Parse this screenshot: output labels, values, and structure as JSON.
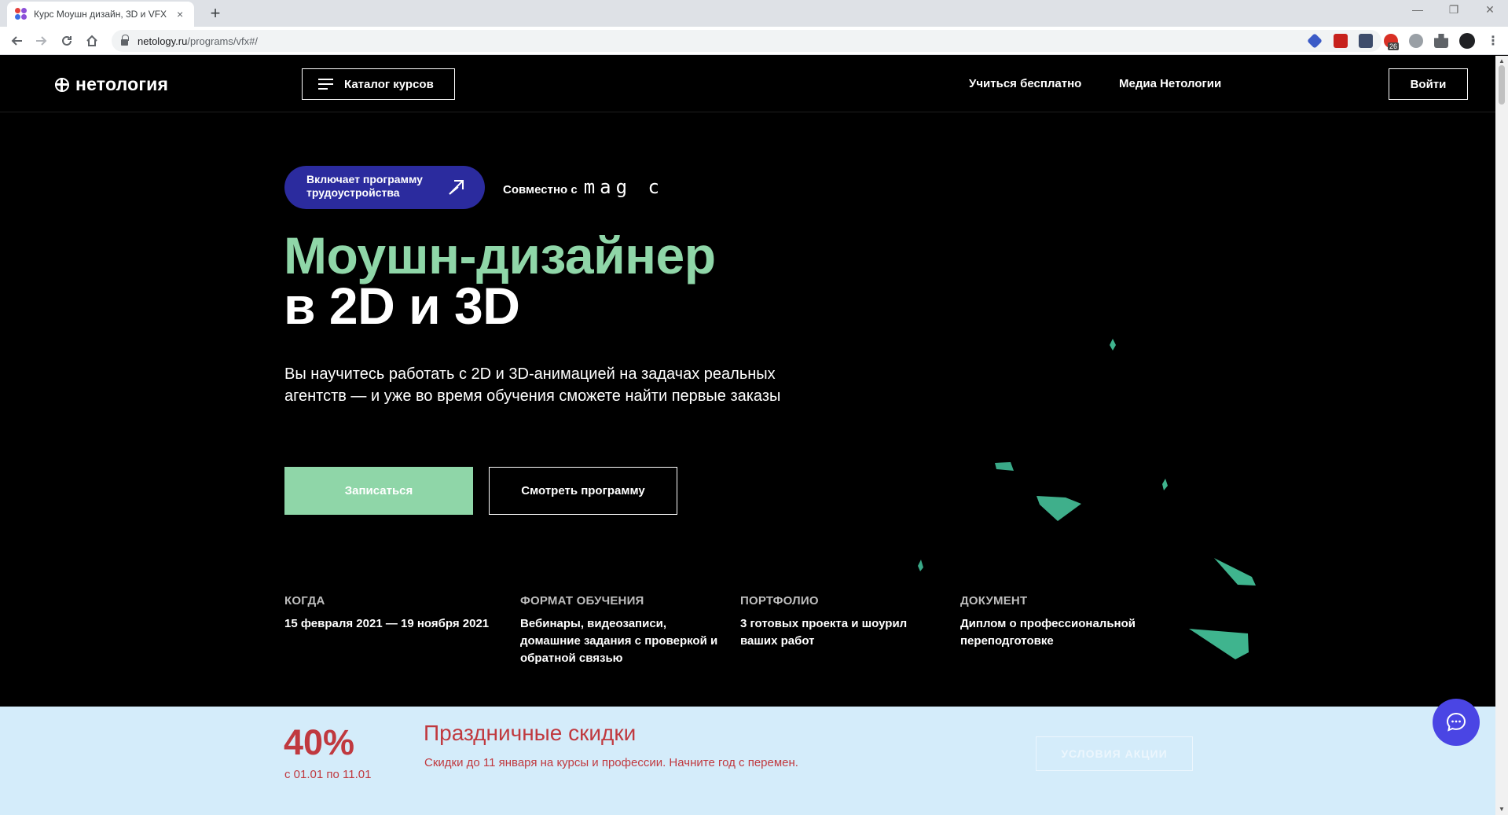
{
  "browser": {
    "tab_title": "Курс Моушн дизайн, 3D и VFX",
    "tab_close": "×",
    "new_tab": "+",
    "url_host": "netology.ru",
    "url_path": "/programs/vfx#/",
    "extension_badge": "26",
    "win_minimize": "—",
    "win_restore": "❐",
    "win_close": "✕"
  },
  "header": {
    "logo_text": "нетология",
    "catalog_label": "Каталог курсов",
    "links": [
      "Учиться бесплатно",
      "Медиа Нетологии"
    ],
    "login_label": "Войти"
  },
  "hero": {
    "badge_line1": "Включает программу",
    "badge_line2": "трудоустройства",
    "partner_label": "Совместно с",
    "partner_logo": "mag c",
    "title_line1": "Моушн-дизайнер",
    "title_line2": "в 2D и 3D",
    "subtitle": "Вы научитесь работать с 2D и 3D-анимацией на задачах реальных агентств — и уже во время обучения сможете найти первые заказы",
    "cta_primary": "Записаться",
    "cta_secondary": "Смотреть программу"
  },
  "facts": [
    {
      "label": "КОГДА",
      "value": "15 февраля 2021 — 19 ноября 2021"
    },
    {
      "label": "ФОРМАТ ОБУЧЕНИЯ",
      "value": "Вебинары, видеозаписи, домашние задания с проверкой и обратной связью"
    },
    {
      "label": "ПОРТФОЛИО",
      "value": "3 готовых проекта и шоурил ваших работ"
    },
    {
      "label": "ДОКУМЕНТ",
      "value": "Диплом о профессиональной переподготовке"
    }
  ],
  "promo": {
    "percent": "40%",
    "dates": "с 01.01 по 11.01",
    "title": "Праздничные скидки",
    "text": "Скидки до 11 января на курсы и профессии.  Начните год с перемен.",
    "button": "УСЛОВИЯ АКЦИИ"
  },
  "colors": {
    "accent_green": "#8fd6a8",
    "badge_blue": "#2b2b9e",
    "promo_bg": "#d4ecfa",
    "promo_red": "#c0393f",
    "chat_purple": "#4a45e4"
  }
}
